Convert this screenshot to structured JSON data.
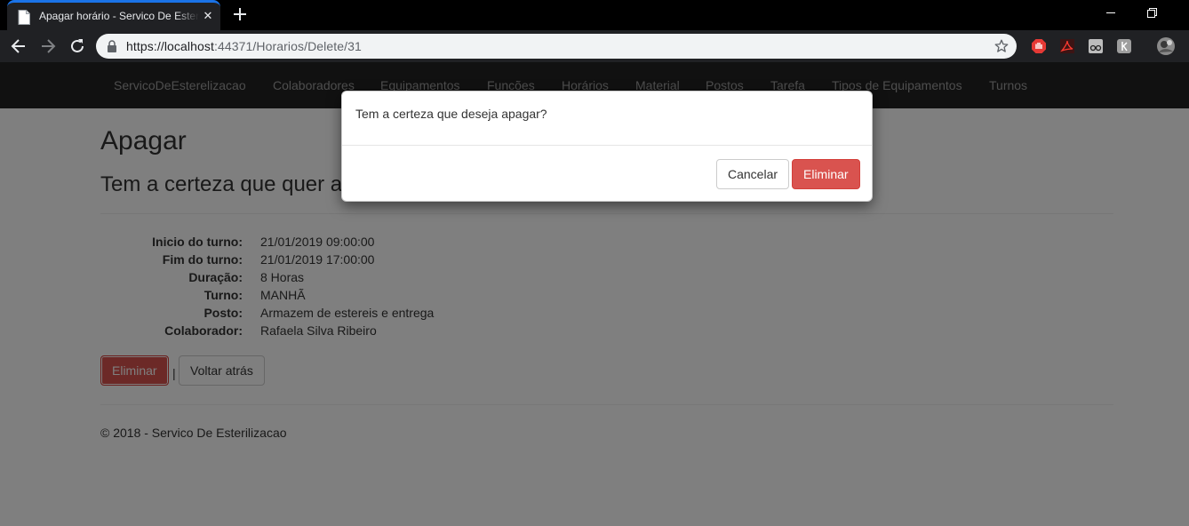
{
  "browser": {
    "tab_title": "Apagar horário - Servico De Esterilizacao",
    "tab_close": "✕",
    "url_host": "https://localhost",
    "url_rest": ":44371/Horarios/Delete/31"
  },
  "navbar": {
    "brand": "ServicoDeEsterelizacao",
    "items": [
      "Colaboradores",
      "Equipamentos",
      "Funcões",
      "Horários",
      "Material",
      "Postos",
      "Tarefa",
      "Tipos de Equipamentos",
      "Turnos"
    ]
  },
  "page": {
    "title": "Apagar",
    "question": "Tem a certeza que quer apagar este?",
    "fields": [
      {
        "label": "Inicio do turno:",
        "value": "21/01/2019 09:00:00"
      },
      {
        "label": "Fim do turno:",
        "value": "21/01/2019 17:00:00"
      },
      {
        "label": "Duração:",
        "value": "8 Horas"
      },
      {
        "label": "Turno:",
        "value": "MANHÃ"
      },
      {
        "label": "Posto:",
        "value": "Armazem de estereis e entrega"
      },
      {
        "label": "Colaborador:",
        "value": "Rafaela Silva Ribeiro"
      }
    ],
    "delete_label": "Eliminar",
    "separator": "|",
    "back_label": "Voltar atrás",
    "footer": "© 2018 - Servico De Esterilizacao"
  },
  "modal": {
    "message": "Tem a certeza que deseja apagar?",
    "cancel_label": "Cancelar",
    "confirm_label": "Eliminar"
  },
  "colors": {
    "danger": "#d9534f",
    "navbar": "#222222",
    "tab_accent": "#1a73e8"
  },
  "icons": [
    "document-icon",
    "close-icon",
    "plus-icon",
    "back-icon",
    "forward-icon",
    "reload-icon",
    "lock-icon",
    "star-icon",
    "adblock-icon",
    "pdf-icon",
    "extension-icon",
    "profile-avatar"
  ]
}
